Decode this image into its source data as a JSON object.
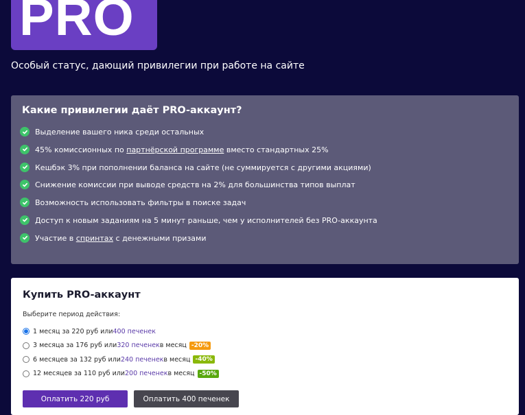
{
  "logo": {
    "text": "PRO"
  },
  "subtitle": "Особый статус, дающий привилегии при работе на сайте",
  "privileges": {
    "title": "Какие привилегии даёт PRO-аккаунт?",
    "items": [
      {
        "parts": [
          {
            "text": "Выделение вашего ника среди остальных"
          }
        ]
      },
      {
        "parts": [
          {
            "text": "45% комиссионных по "
          },
          {
            "text": "партнёрской программе",
            "link": true
          },
          {
            "text": " вместо стандартных 25%"
          }
        ]
      },
      {
        "parts": [
          {
            "text": "Кешбэк 3% при пополнении баланса на сайте (не суммируется с другими акциями)"
          }
        ]
      },
      {
        "parts": [
          {
            "text": "Снижение комиссии при выводе средств на 2% для большинства типов выплат"
          }
        ]
      },
      {
        "parts": [
          {
            "text": "Возможность использовать фильтры в поиске задач"
          }
        ]
      },
      {
        "parts": [
          {
            "text": "Доступ к новым заданиям на 5 минут раньше, чем у исполнителей без PRO-аккаунта"
          }
        ]
      },
      {
        "parts": [
          {
            "text": "Участие в "
          },
          {
            "text": "спринтах",
            "link": true
          },
          {
            "text": " с денежными призами"
          }
        ]
      }
    ]
  },
  "buy": {
    "title": "Купить PRO-аккаунт",
    "period_label": "Выберите период действия:",
    "options": [
      {
        "text": "1 месяц за 220 руб или ",
        "cookies": "400 печенек",
        "suffix": "",
        "badge": "",
        "badge_color": "",
        "checked": true
      },
      {
        "text": "3 месяца за 176 руб или ",
        "cookies": "320 печенек",
        "suffix": " в месяц",
        "badge": "-20%",
        "badge_color": "#f59a0f",
        "checked": false
      },
      {
        "text": "6 месяцев за 132 руб или ",
        "cookies": "240 печенек",
        "suffix": " в месяц",
        "badge": "-40%",
        "badge_color": "#8ab80a",
        "checked": false
      },
      {
        "text": "12 месяцев за 110 руб или ",
        "cookies": "200 печенек",
        "suffix": " в месяц",
        "badge": "-50%",
        "badge_color": "#58a80e",
        "checked": false
      }
    ],
    "pay_rub_label": "Оплатить 220 руб",
    "pay_cookies_label": "Оплатить 400 печенек"
  }
}
